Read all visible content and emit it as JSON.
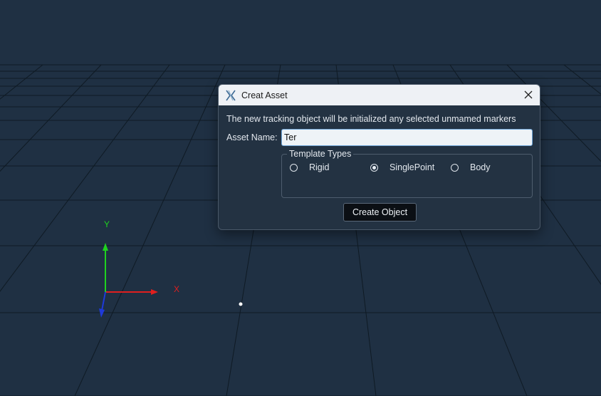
{
  "viewport": {
    "axes": {
      "y_label": "Y",
      "x_label": "X"
    },
    "colors": {
      "background": "#1f3043",
      "grid": "#0f1a24",
      "x_axis": "#e01f1f",
      "y_axis": "#1fd11f",
      "z_axis": "#1f3ad9"
    }
  },
  "dialog": {
    "title": "Creat Asset",
    "info_text": "The new tracking object will be initialized any selected unmamed markers",
    "asset_name_label": "Asset Name:",
    "asset_name_value": "Ter",
    "template_types": {
      "title": "Template Types",
      "options": [
        {
          "label": "Rigid",
          "selected": false
        },
        {
          "label": "SinglePoint",
          "selected": true
        },
        {
          "label": "Body",
          "selected": false
        }
      ]
    },
    "create_button": "Create Object",
    "icons": {
      "app": "app-logo-icon",
      "close": "close-icon"
    }
  }
}
